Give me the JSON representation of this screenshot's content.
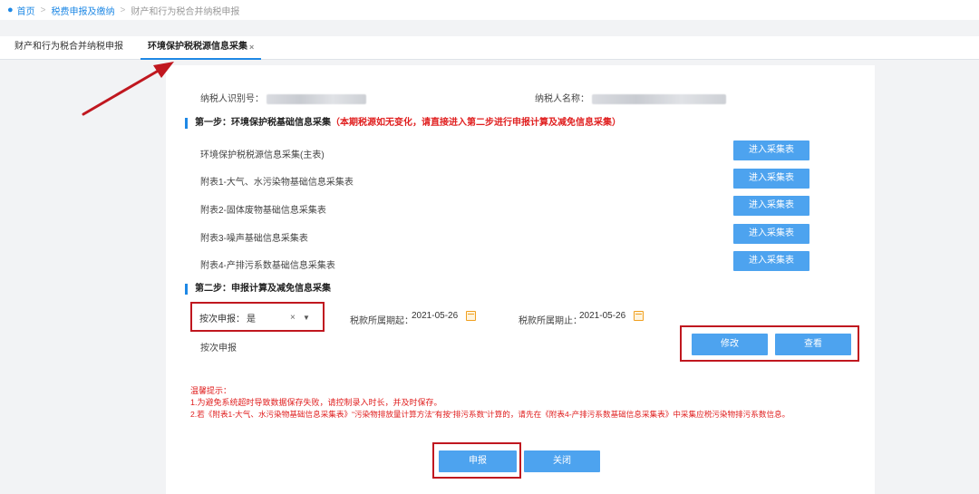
{
  "breadcrumb": {
    "home": "首页",
    "item2": "税费申报及缴纳",
    "current": "财产和行为税合并纳税申报"
  },
  "tabs": [
    {
      "label": "财产和行为税合并纳税申报"
    },
    {
      "label": "环境保护税税源信息采集",
      "close": "×"
    }
  ],
  "taxpayer": {
    "id_label": "纳税人识别号：",
    "name_label": "纳税人名称："
  },
  "step1": {
    "title": "第一步：环境保护税基础信息采集",
    "note": "（本期税源如无变化，请直接进入第二步进行申报计算及减免信息采集）",
    "forms": [
      {
        "label": "环境保护税税源信息采集(主表)",
        "button": "进入采集表"
      },
      {
        "label": "附表1-大气、水污染物基础信息采集表",
        "button": "进入采集表"
      },
      {
        "label": "附表2-固体废物基础信息采集表",
        "button": "进入采集表"
      },
      {
        "label": "附表3-噪声基础信息采集表",
        "button": "进入采集表"
      },
      {
        "label": "附表4-产排污系数基础信息采集表",
        "button": "进入采集表"
      }
    ]
  },
  "step2": {
    "title": "第二步：申报计算及减免信息采集",
    "declare_by_times_label": "按次申报：",
    "declare_by_times_value": "是",
    "clear": "×",
    "caret": "▼",
    "period_start_label": "税款所属期起：",
    "period_start_value": "2021-05-26",
    "period_end_label": "税款所属期止：",
    "period_end_value": "2021-05-26",
    "row_label": "按次申报",
    "modify_button": "修改",
    "view_button": "查看"
  },
  "tips": {
    "title": "温馨提示：",
    "line1": "1.为避免系统超时导致数据保存失败，请控制录入时长，并及时保存。",
    "line2": "2.若《附表1-大气、水污染物基础信息采集表》“污染物排放量计算方法”有按“排污系数”计算的，请先在《附表4-产排污系数基础信息采集表》中采集应税污染物排污系数信息。"
  },
  "footer": {
    "submit_button": "申报",
    "close_button": "关闭"
  },
  "colors": {
    "accent": "#1e88e5",
    "button": "#4da3ef",
    "warning": "#e02020",
    "highlight_box": "#c0171f"
  }
}
